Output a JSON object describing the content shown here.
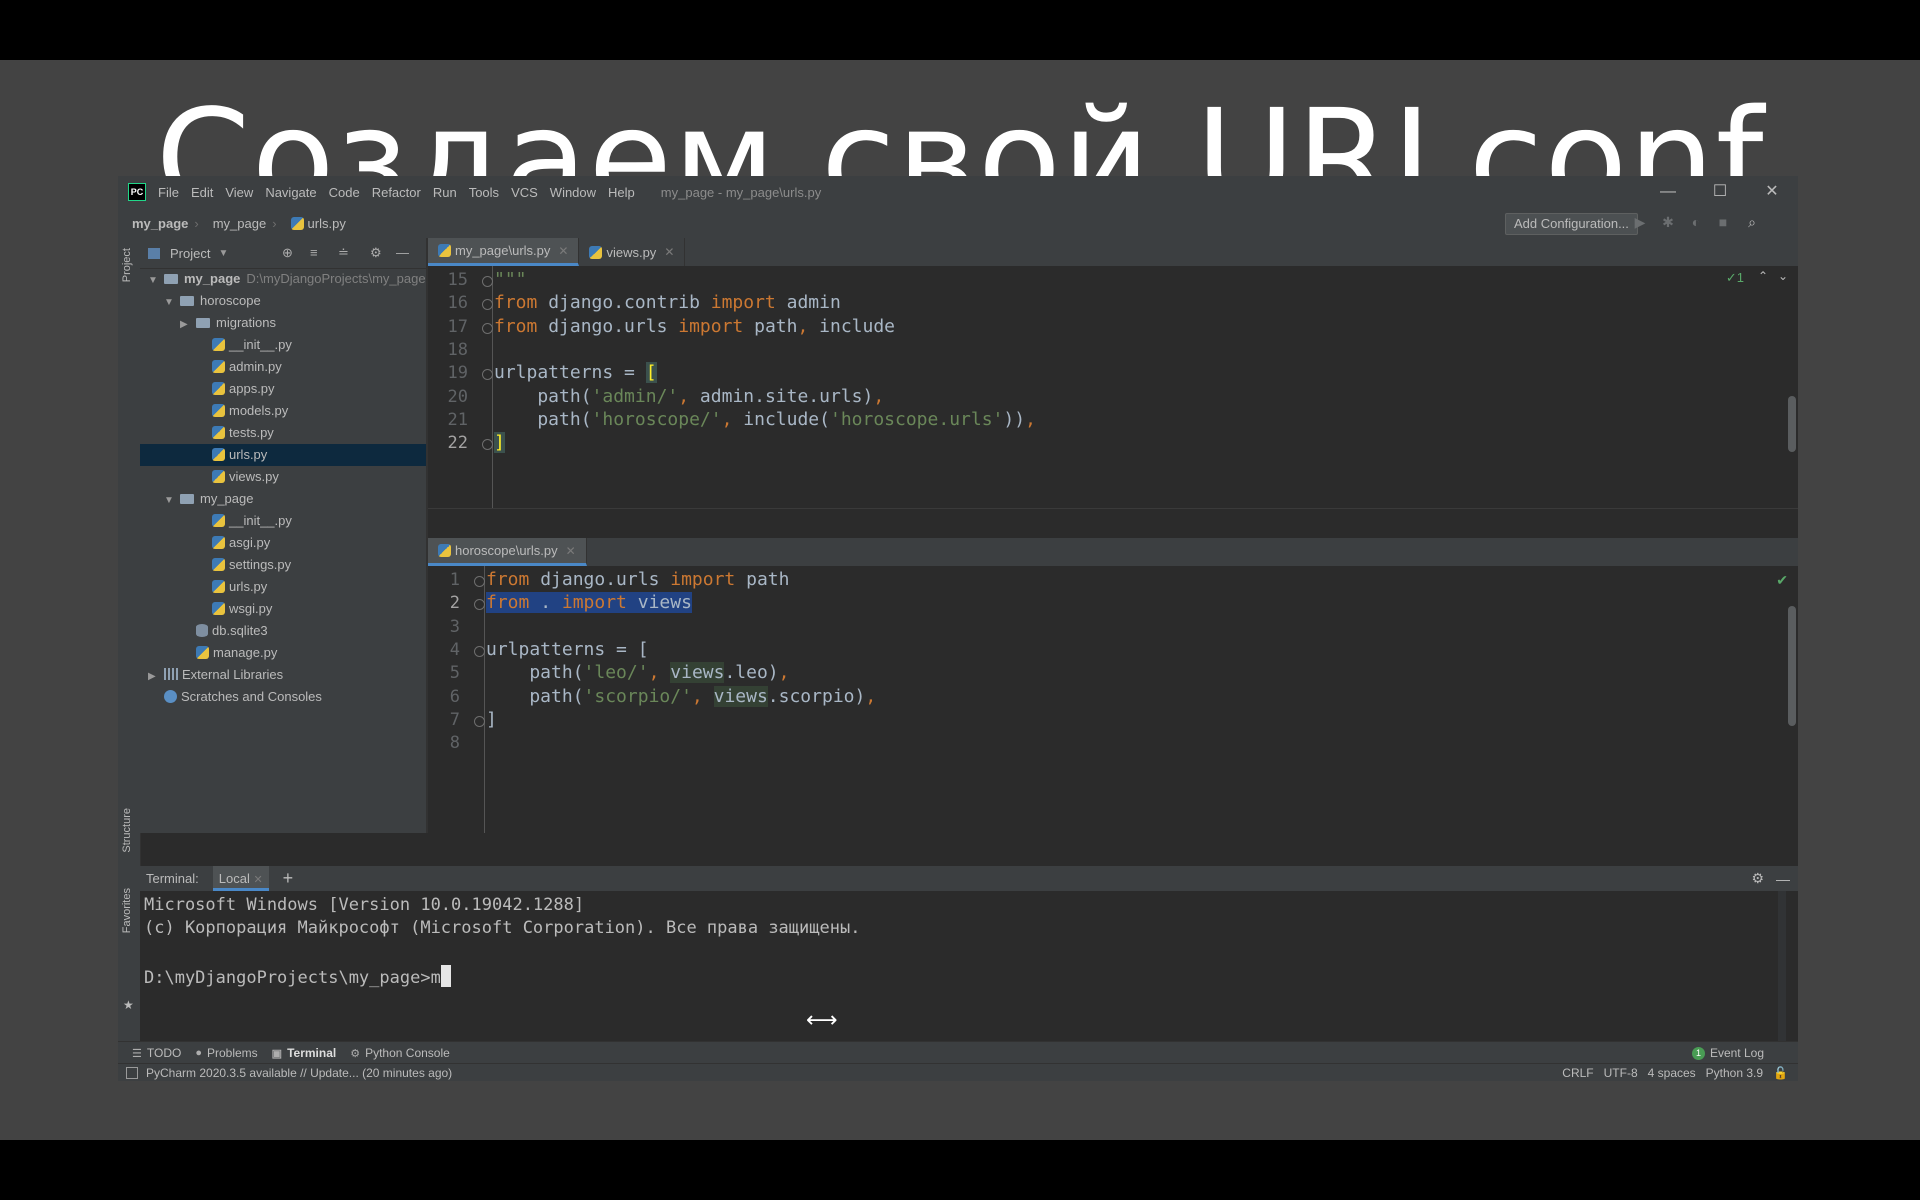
{
  "slide": {
    "title": "Создаем свой URLconf"
  },
  "window": {
    "title": "my_page - my_page\\urls.py",
    "logo": "PC",
    "menu": [
      "File",
      "Edit",
      "View",
      "Navigate",
      "Code",
      "Refactor",
      "Run",
      "Tools",
      "VCS",
      "Window",
      "Help"
    ],
    "controls": {
      "minimize": "—",
      "maximize": "☐",
      "close": "✕"
    }
  },
  "navbar": {
    "crumbs": [
      "my_page",
      "my_page",
      "urls.py"
    ],
    "add_configuration": "Add Configuration...",
    "icons": [
      "run-icon",
      "debug-icon",
      "coverage-icon",
      "stop-icon",
      "search-icon"
    ]
  },
  "left_strip": {
    "project": "Project",
    "structure": "Structure",
    "favorites": "Favorites"
  },
  "project_panel": {
    "header": "Project",
    "tree": [
      {
        "label": "my_page",
        "extra": "D:\\myDjangoProjects\\my_page",
        "type": "folder",
        "level": 0,
        "expanded": true,
        "bold": true
      },
      {
        "label": "horoscope",
        "type": "folder",
        "level": 1,
        "expanded": true
      },
      {
        "label": "migrations",
        "type": "folder",
        "level": 2,
        "expanded": false
      },
      {
        "label": "__init__.py",
        "type": "py",
        "level": 3
      },
      {
        "label": "admin.py",
        "type": "py",
        "level": 3
      },
      {
        "label": "apps.py",
        "type": "py",
        "level": 3
      },
      {
        "label": "models.py",
        "type": "py",
        "level": 3
      },
      {
        "label": "tests.py",
        "type": "py",
        "level": 3
      },
      {
        "label": "urls.py",
        "type": "py",
        "level": 3,
        "selected": true
      },
      {
        "label": "views.py",
        "type": "py",
        "level": 3
      },
      {
        "label": "my_page",
        "type": "folder",
        "level": 1,
        "expanded": true
      },
      {
        "label": "__init__.py",
        "type": "py",
        "level": 3
      },
      {
        "label": "asgi.py",
        "type": "py",
        "level": 3
      },
      {
        "label": "settings.py",
        "type": "py",
        "level": 3
      },
      {
        "label": "urls.py",
        "type": "py",
        "level": 3
      },
      {
        "label": "wsgi.py",
        "type": "py",
        "level": 3
      },
      {
        "label": "db.sqlite3",
        "type": "db",
        "level": 2
      },
      {
        "label": "manage.py",
        "type": "py",
        "level": 2
      },
      {
        "label": "External Libraries",
        "type": "lib",
        "level": 0,
        "expanded": false
      },
      {
        "label": "Scratches and Consoles",
        "type": "scratch",
        "level": 0
      }
    ]
  },
  "editor_top": {
    "tabs": [
      {
        "label": "my_page\\urls.py",
        "active": true
      },
      {
        "label": "views.py",
        "active": false
      }
    ],
    "inspection": "✓1",
    "lines": [
      {
        "n": "15",
        "html": "<span class=\"str\">\"\"\"</span>"
      },
      {
        "n": "16",
        "html": "<span class=\"kw\">from</span> django.contrib <span class=\"kw\">import</span> admin"
      },
      {
        "n": "17",
        "html": "<span class=\"kw\">from</span> django.urls <span class=\"kw\">import</span> path<span class=\"kw\">,</span> include"
      },
      {
        "n": "18",
        "html": ""
      },
      {
        "n": "19",
        "html": "urlpatterns = <span class=\"bracket\">[</span>"
      },
      {
        "n": "20",
        "html": "    path(<span class=\"str\">'admin/'</span><span class=\"kw\">,</span> admin.site.urls)<span class=\"kw\">,</span>"
      },
      {
        "n": "21",
        "html": "    path(<span class=\"str\">'horoscope/'</span><span class=\"kw\">,</span> include(<span class=\"str\">'horoscope.urls'</span>))<span class=\"kw\">,</span>"
      },
      {
        "n": "22",
        "html": "<span class=\"bracket\">]</span>",
        "current": true
      }
    ]
  },
  "editor_bottom": {
    "tabs": [
      {
        "label": "horoscope\\urls.py",
        "active": true
      }
    ],
    "lines": [
      {
        "n": "1",
        "html": "<span class=\"kw\">from</span> django.urls <span class=\"kw\">import</span> path"
      },
      {
        "n": "2",
        "html": "<span class=\"hl\"><span class=\"kw\">from</span> . <span class=\"kw\">import</span> views</span>",
        "current": true
      },
      {
        "n": "3",
        "html": ""
      },
      {
        "n": "4",
        "html": "urlpatterns = ["
      },
      {
        "n": "5",
        "html": "    path(<span class=\"str\">'leo/'</span><span class=\"kw\">,</span> <span class=\"usage\">views</span>.leo)<span class=\"kw\">,</span>"
      },
      {
        "n": "6",
        "html": "    path(<span class=\"str\">'scorpio/'</span><span class=\"kw\">,</span> <span class=\"usage\">views</span>.scorpio)<span class=\"kw\">,</span>"
      },
      {
        "n": "7",
        "html": "]"
      },
      {
        "n": "8",
        "html": ""
      }
    ]
  },
  "terminal": {
    "label": "Terminal:",
    "tab": "Local",
    "add": "+",
    "lines": [
      "Microsoft Windows [Version 10.0.19042.1288]",
      "(c) Корпорация Майкрософт (Microsoft Corporation). Все права защищены.",
      "",
      "D:\\myDjangoProjects\\my_page>m"
    ]
  },
  "bottom_tabs": [
    {
      "label": "TODO",
      "icon": "list-icon"
    },
    {
      "label": "Problems",
      "icon": "problems-icon"
    },
    {
      "label": "Terminal",
      "icon": "terminal-icon",
      "active": true
    },
    {
      "label": "Python Console",
      "icon": "python-console-icon"
    }
  ],
  "event_log": {
    "count": "1",
    "label": "Event Log"
  },
  "status": {
    "message": "PyCharm 2020.3.5 available // Update... (20 minutes ago)",
    "line_sep": "CRLF",
    "encoding": "UTF-8",
    "indent": "4 spaces",
    "interpreter": "Python 3.9"
  }
}
